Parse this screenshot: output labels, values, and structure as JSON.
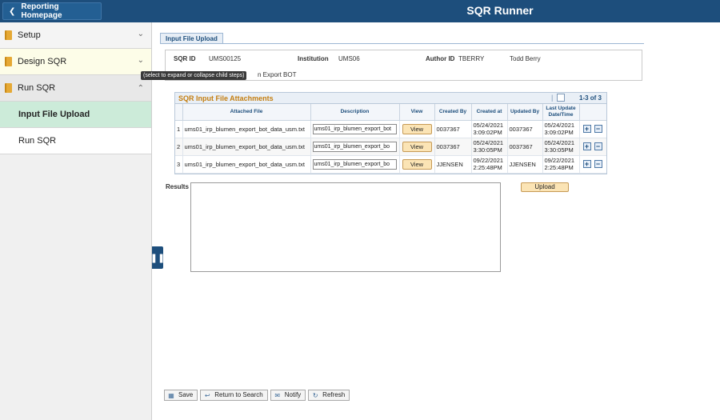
{
  "header": {
    "home_label": "Reporting Homepage",
    "app_title": "SQR Runner"
  },
  "sidenav": {
    "items": [
      {
        "label": "Setup"
      },
      {
        "label": "Design SQR"
      },
      {
        "label": "Run SQR"
      }
    ],
    "children": [
      {
        "label": "Input File Upload"
      },
      {
        "label": "Run SQR"
      }
    ],
    "tooltip": "(select to expand or collapse child steps)"
  },
  "page": {
    "tab_label": "Input File Upload",
    "info": {
      "sqr_id_label": "SQR ID",
      "sqr_id": "UMS00125",
      "institution_label": "Institution",
      "institution": "UMS06",
      "author_label": "Author ID",
      "author_id": "TBERRY",
      "author_name": "Todd Berry",
      "description_fragment": "n Export BOT"
    }
  },
  "grid": {
    "title": "SQR Input File Attachments",
    "count": "1-3 of 3",
    "columns": {
      "attached_file": "Attached File",
      "description": "Description",
      "view": "View",
      "created_by": "Created By",
      "created_at": "Created at",
      "updated_by": "Updated By",
      "last_update": "Last Update Date/Time"
    },
    "rows": [
      {
        "num": "1",
        "file": "ums01_irp_blumen_export_bot_data_usm.txt",
        "desc": "ums01_irp_blumen_export_bot",
        "view": "View",
        "created_by": "0037367",
        "created_date": "05/24/2021",
        "created_time": "3:09:02PM",
        "updated_by": "0037367",
        "updated_date": "05/24/2021",
        "updated_time": "3:09:02PM"
      },
      {
        "num": "2",
        "file": "ums01_irp_blumen_export_bot_data_usm.txt",
        "desc": "ums01_irp_blumen_export_bo",
        "view": "View",
        "created_by": "0037367",
        "created_date": "05/24/2021",
        "created_time": "3:30:05PM",
        "updated_by": "0037367",
        "updated_date": "05/24/2021",
        "updated_time": "3:30:05PM"
      },
      {
        "num": "3",
        "file": "ums01_irp_blumen_export_bot_data_usm.txt",
        "desc": "ums01_irp_blumen_export_bo",
        "view": "View",
        "created_by": "JJENSEN",
        "created_date": "09/22/2021",
        "created_time": "2:25:48PM",
        "updated_by": "JJENSEN",
        "updated_date": "09/22/2021",
        "updated_time": "2:25:48PM"
      }
    ]
  },
  "results": {
    "label": "Results",
    "value": "",
    "upload_label": "Upload"
  },
  "toolbar": {
    "save": "Save",
    "return": "Return to Search",
    "notify": "Notify",
    "refresh": "Refresh"
  }
}
